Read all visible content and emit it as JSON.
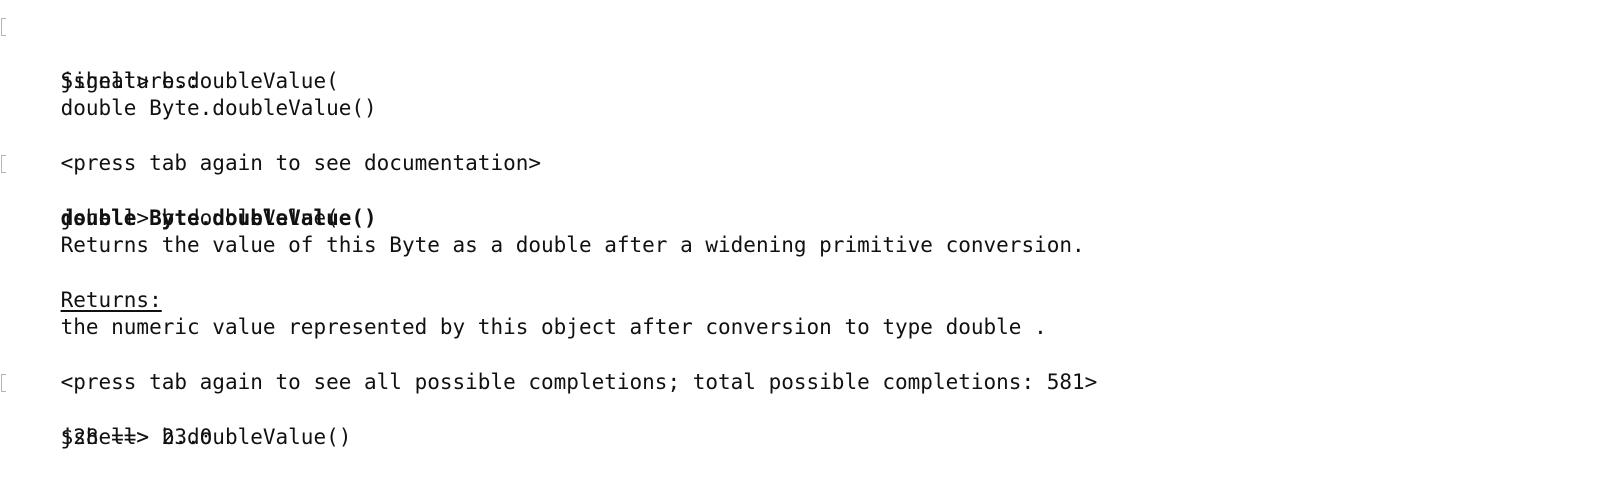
{
  "terminal": {
    "lines": [
      {
        "kind": "prompt",
        "text": "jshell> b.doubleValue("
      },
      {
        "kind": "output",
        "text": "Signatures:"
      },
      {
        "kind": "output",
        "text": "double Byte.doubleValue()"
      },
      {
        "kind": "blank",
        "text": ""
      },
      {
        "kind": "output",
        "text": "<press tab again to see documentation>"
      },
      {
        "kind": "prompt",
        "text": "jshell> b.doubleValue("
      },
      {
        "kind": "bold",
        "text": "double Byte.doubleValue()"
      },
      {
        "kind": "output",
        "text": "Returns the value of this Byte as a double after a widening primitive conversion."
      },
      {
        "kind": "blank",
        "text": ""
      },
      {
        "kind": "underline",
        "text": "Returns:"
      },
      {
        "kind": "output",
        "text": "the numeric value represented by this object after conversion to type double ."
      },
      {
        "kind": "blank",
        "text": ""
      },
      {
        "kind": "output",
        "text": "<press tab again to see all possible completions; total possible completions: 581>"
      },
      {
        "kind": "prompt",
        "text": "jshell> b.doubleValue()"
      },
      {
        "kind": "output",
        "text": "$28 ==> 23.0"
      }
    ]
  }
}
